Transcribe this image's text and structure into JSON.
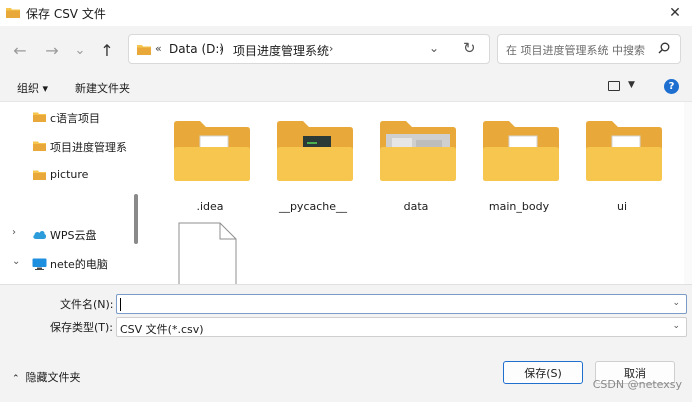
{
  "window": {
    "title": "保存 CSV 文件",
    "close": "✕"
  },
  "navigation": {
    "back": "←",
    "forward": "→",
    "recent": "⌄",
    "up": "↑",
    "address": {
      "overflow": "«",
      "segments": [
        "Data (D:)",
        "项目进度管理系统"
      ],
      "dropdown": "⌄",
      "refresh": "↻"
    },
    "search_placeholder": "在 项目进度管理系统 中搜索"
  },
  "toolbar": {
    "organize": "组织 ▾",
    "new_folder": "新建文件夹",
    "help": "?"
  },
  "sidebar": {
    "folders": [
      "c语言项目",
      "项目进度管理系",
      "picture"
    ],
    "drives": [
      {
        "label": "WPS云盘",
        "chevron": "›"
      },
      {
        "label": "nete的电脑",
        "chevron": "⌄"
      }
    ]
  },
  "content": {
    "folders": [
      {
        "name": ".idea",
        "icon": "folder-doc-icon"
      },
      {
        "name": "__pycache__",
        "icon": "folder-pycache-icon"
      },
      {
        "name": "data",
        "icon": "folder-data-icon"
      },
      {
        "name": "main_body",
        "icon": "folder-doc-icon"
      },
      {
        "name": "ui",
        "icon": "folder-doc-icon"
      }
    ]
  },
  "form": {
    "filename_label": "文件名(N):",
    "filename_value": "",
    "filetype_label": "保存类型(T):",
    "filetype_value": "CSV 文件(*.csv)"
  },
  "footer": {
    "hide_folders": "隐藏文件夹",
    "save_button": "保存(S)",
    "cancel_button": "取消",
    "watermark": "CSDN @netexsy"
  },
  "colors": {
    "accent": "#1f6fd0",
    "folder": "#f6c64f",
    "folder_dark": "#e8a93a",
    "chrome": "#f3f3f3"
  }
}
